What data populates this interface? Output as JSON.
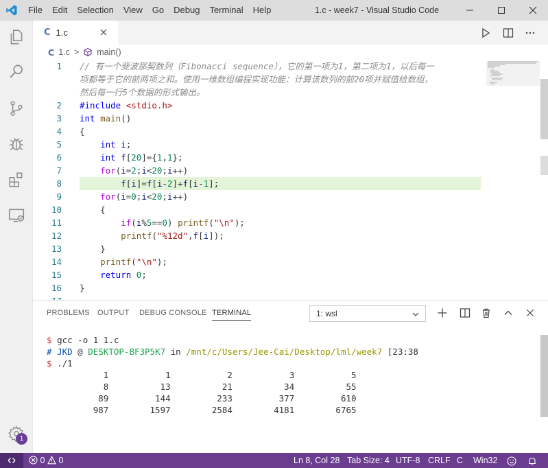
{
  "titlebar": {
    "menu": [
      "File",
      "Edit",
      "Selection",
      "View",
      "Go",
      "Debug",
      "Terminal",
      "Help"
    ],
    "window_title": "1.c - week7 - Visual Studio Code"
  },
  "activitybar": {
    "icons": [
      "explorer-icon",
      "search-icon",
      "source-control-icon",
      "debug-icon",
      "extensions-icon",
      "remote-explorer-icon"
    ],
    "manage_badge": "1"
  },
  "tab": {
    "lang": "C",
    "label": "1.c"
  },
  "breadcrumb": {
    "lang": "C",
    "file": "1.c",
    "separator": ">",
    "symbol": "main()"
  },
  "editor": {
    "current_line": 8,
    "lines": [
      {
        "n": "1",
        "text": "// 有一个斐波那契数列（Fibonacci sequence），它的第一项为1，第二项为1，以后每一"
      },
      {
        "n": "",
        "text": "项都等于它的前两项之和。使用一维数组编程实现功能：计算该数列的前20项并赋值给数组，"
      },
      {
        "n": "",
        "text": "然后每一行5个数据的形式输出。"
      },
      {
        "n": "2",
        "text": "#include <stdio.h>"
      },
      {
        "n": "3",
        "text": "int main()"
      },
      {
        "n": "4",
        "text": "{"
      },
      {
        "n": "5",
        "text": "    int i;"
      },
      {
        "n": "6",
        "text": "    int f[20]={1,1};"
      },
      {
        "n": "7",
        "text": "    for(i=2;i<20;i++)"
      },
      {
        "n": "8",
        "text": "        f[i]=f[i-2]+f[i-1];"
      },
      {
        "n": "9",
        "text": "    for(i=0;i<20;i++)"
      },
      {
        "n": "10",
        "text": "    {"
      },
      {
        "n": "11",
        "text": "        if(i%5==0) printf(\"\\n\");"
      },
      {
        "n": "12",
        "text": "        printf(\"%12d\",f[i]);"
      },
      {
        "n": "13",
        "text": "    }"
      },
      {
        "n": "14",
        "text": "    printf(\"\\n\");"
      },
      {
        "n": "15",
        "text": "    return 0;"
      },
      {
        "n": "16",
        "text": "}"
      },
      {
        "n": "17",
        "text": ""
      }
    ]
  },
  "panel": {
    "tabs": [
      "PROBLEMS",
      "OUTPUT",
      "DEBUG CONSOLE",
      "TERMINAL"
    ],
    "active_tab": "TERMINAL",
    "terminal_select": "1: wsl",
    "terminal": {
      "prompt1": "$",
      "cmd1": "gcc -o 1 1.c",
      "hash": "#",
      "user": "JKD",
      "at": "@",
      "host": "DESKTOP-BF3P5K7",
      "in": "in",
      "path": "/mnt/c/Users/Jee-Cai/Desktop/lml/week7",
      "time": "[23:38",
      "prompt2": "$",
      "cmd2": "./1",
      "output_rows": [
        [
          "1",
          "1",
          "2",
          "3",
          "5"
        ],
        [
          "8",
          "13",
          "21",
          "34",
          "55"
        ],
        [
          "89",
          "144",
          "233",
          "377",
          "610"
        ],
        [
          "987",
          "1597",
          "2584",
          "4181",
          "6765"
        ]
      ]
    }
  },
  "statusbar": {
    "errors": "0",
    "warnings": "0",
    "position": "Ln 8, Col 28",
    "tab_size": "Tab Size: 4",
    "encoding": "UTF-8",
    "eol": "CRLF",
    "language": "C",
    "platform": "Win32"
  },
  "colors": {
    "accent": "#007acc",
    "statusbar": "#6a3d8f",
    "current_line": "#e4f4d8"
  }
}
